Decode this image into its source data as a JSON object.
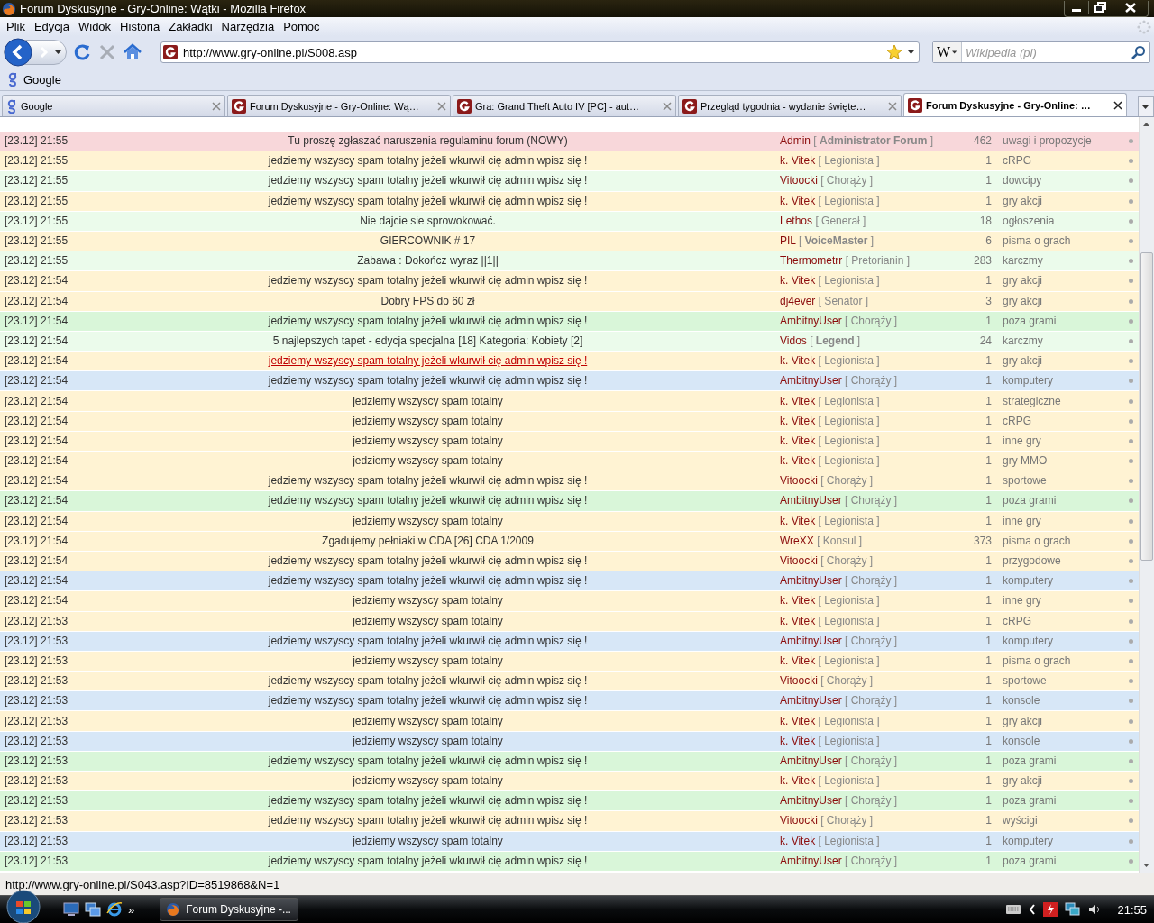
{
  "window": {
    "title": "Forum Dyskusyjne - Gry-Online: Wątki - Mozilla Firefox"
  },
  "menu": [
    "Plik",
    "Edycja",
    "Widok",
    "Historia",
    "Zakładki",
    "Narzędzia",
    "Pomoc"
  ],
  "navigation": {
    "url": "http://www.gry-online.pl/S008.asp",
    "search_engine": "W",
    "search_placeholder": "Wikipedia (pl)",
    "stop_disabled": true
  },
  "bookmarks": [
    "Google"
  ],
  "tabs": [
    {
      "title": "Google",
      "kind": "google",
      "selected": false
    },
    {
      "title": "Forum Dyskusyjne - Gry-Online: Wą…",
      "kind": "site",
      "selected": false
    },
    {
      "title": "Gra: Grand Theft Auto IV [PC] - aut…",
      "kind": "site",
      "selected": false
    },
    {
      "title": "Przegląd tygodnia - wydanie święte…",
      "kind": "site",
      "selected": false
    },
    {
      "title": "Forum Dyskusyjne - Gry-Online: …",
      "kind": "site",
      "selected": true
    }
  ],
  "threads": [
    {
      "time": "[23.12] 21:55",
      "title": "Tu proszę zgłaszać naruszenia regulaminu forum (NOWY)",
      "author": "Admin",
      "rank": "[ **Administrator Forum** ]",
      "count": "462",
      "category": "uwagi i propozycje",
      "color": "#f8d7da",
      "hovered": false
    },
    {
      "time": "[23.12] 21:55",
      "title": "jedziemy wszyscy spam totalny jeżeli wkurwił cię admin wpisz się !",
      "author": "k. Vitek",
      "rank": "[ Legionista ]",
      "count": "1",
      "category": "cRPG",
      "color": "#fff3d3",
      "hovered": false
    },
    {
      "time": "[23.12] 21:55",
      "title": "jedziemy wszyscy spam totalny jeżeli wkurwił cię admin wpisz się !",
      "author": "Vitoocki",
      "rank": "[ Chorąży ]",
      "count": "1",
      "category": "dowcipy",
      "color": "#ebfbeb",
      "hovered": false
    },
    {
      "time": "[23.12] 21:55",
      "title": "jedziemy wszyscy spam totalny jeżeli wkurwił cię admin wpisz się !",
      "author": "k. Vitek",
      "rank": "[ Legionista ]",
      "count": "1",
      "category": "gry akcji",
      "color": "#fff3d3",
      "hovered": false
    },
    {
      "time": "[23.12] 21:55",
      "title": "Nie dajcie sie sprowokować.",
      "author": "Lethos",
      "rank": "[ Generał ]",
      "count": "18",
      "category": "ogłoszenia",
      "color": "#ebfbeb",
      "hovered": false
    },
    {
      "time": "[23.12] 21:55",
      "title": "GIERCOWNIK # 17",
      "author": "PIL",
      "rank": "[ **VoiceMaster** ]",
      "count": "6",
      "category": "pisma o grach",
      "color": "#fff3d3",
      "hovered": false
    },
    {
      "time": "[23.12] 21:55",
      "title": "Zabawa : Dokończ wyraz ||1||",
      "author": "Thermometrr",
      "rank": "[ Pretorianin ]",
      "count": "283",
      "category": "karczmy",
      "color": "#ebfbeb",
      "hovered": false
    },
    {
      "time": "[23.12] 21:54",
      "title": "jedziemy wszyscy spam totalny jeżeli wkurwił cię admin wpisz się !",
      "author": "k. Vitek",
      "rank": "[ Legionista ]",
      "count": "1",
      "category": "gry akcji",
      "color": "#fff3d3",
      "hovered": false
    },
    {
      "time": "[23.12] 21:54",
      "title": "Dobry FPS do 60 zł",
      "author": "dj4ever",
      "rank": "[ Senator ]",
      "count": "3",
      "category": "gry akcji",
      "color": "#fff3d3",
      "hovered": false
    },
    {
      "time": "[23.12] 21:54",
      "title": "jedziemy wszyscy spam totalny jeżeli wkurwił cię admin wpisz się !",
      "author": "AmbitnyUser",
      "rank": "[ Chorąży ]",
      "count": "1",
      "category": "poza grami",
      "color": "#d9f6d9",
      "hovered": false
    },
    {
      "time": "[23.12] 21:54",
      "title": "5 najlepszych tapet - edycja specjalna [18] Kategoria: Kobiety [2]",
      "author": "Vidos",
      "rank": "[ **Legend** ]",
      "count": "24",
      "category": "karczmy",
      "color": "#ebfbeb",
      "hovered": false
    },
    {
      "time": "[23.12] 21:54",
      "title": "jedziemy wszyscy spam totalny jeżeli wkurwił cię admin wpisz się !",
      "author": "k. Vitek",
      "rank": "[ Legionista ]",
      "count": "1",
      "category": "gry akcji",
      "color": "#fff3d3",
      "hovered": true
    },
    {
      "time": "[23.12] 21:54",
      "title": "jedziemy wszyscy spam totalny jeżeli wkurwił cię admin wpisz się !",
      "author": "AmbitnyUser",
      "rank": "[ Chorąży ]",
      "count": "1",
      "category": "komputery",
      "color": "#d7e7f7",
      "hovered": false
    },
    {
      "time": "[23.12] 21:54",
      "title": "jedziemy wszyscy spam totalny",
      "author": "k. Vitek",
      "rank": "[ Legionista ]",
      "count": "1",
      "category": "strategiczne",
      "color": "#fff3d3",
      "hovered": false
    },
    {
      "time": "[23.12] 21:54",
      "title": "jedziemy wszyscy spam totalny",
      "author": "k. Vitek",
      "rank": "[ Legionista ]",
      "count": "1",
      "category": "cRPG",
      "color": "#fff3d3",
      "hovered": false
    },
    {
      "time": "[23.12] 21:54",
      "title": "jedziemy wszyscy spam totalny",
      "author": "k. Vitek",
      "rank": "[ Legionista ]",
      "count": "1",
      "category": "inne gry",
      "color": "#fff3d3",
      "hovered": false
    },
    {
      "time": "[23.12] 21:54",
      "title": "jedziemy wszyscy spam totalny",
      "author": "k. Vitek",
      "rank": "[ Legionista ]",
      "count": "1",
      "category": "gry MMO",
      "color": "#fff3d3",
      "hovered": false
    },
    {
      "time": "[23.12] 21:54",
      "title": "jedziemy wszyscy spam totalny jeżeli wkurwił cię admin wpisz się !",
      "author": "Vitoocki",
      "rank": "[ Chorąży ]",
      "count": "1",
      "category": "sportowe",
      "color": "#fff3d3",
      "hovered": false
    },
    {
      "time": "[23.12] 21:54",
      "title": "jedziemy wszyscy spam totalny jeżeli wkurwił cię admin wpisz się !",
      "author": "AmbitnyUser",
      "rank": "[ Chorąży ]",
      "count": "1",
      "category": "poza grami",
      "color": "#d9f6d9",
      "hovered": false
    },
    {
      "time": "[23.12] 21:54",
      "title": "jedziemy wszyscy spam totalny",
      "author": "k. Vitek",
      "rank": "[ Legionista ]",
      "count": "1",
      "category": "inne gry",
      "color": "#fff3d3",
      "hovered": false
    },
    {
      "time": "[23.12] 21:54",
      "title": "Zgadujemy pełniaki w CDA [26] CDA 1/2009",
      "author": "WreXX",
      "rank": "[ Konsul ]",
      "count": "373",
      "category": "pisma o grach",
      "color": "#fff3d3",
      "hovered": false
    },
    {
      "time": "[23.12] 21:54",
      "title": "jedziemy wszyscy spam totalny jeżeli wkurwił cię admin wpisz się !",
      "author": "Vitoocki",
      "rank": "[ Chorąży ]",
      "count": "1",
      "category": "przygodowe",
      "color": "#fff3d3",
      "hovered": false
    },
    {
      "time": "[23.12] 21:54",
      "title": "jedziemy wszyscy spam totalny jeżeli wkurwił cię admin wpisz się !",
      "author": "AmbitnyUser",
      "rank": "[ Chorąży ]",
      "count": "1",
      "category": "komputery",
      "color": "#d7e7f7",
      "hovered": false
    },
    {
      "time": "[23.12] 21:54",
      "title": "jedziemy wszyscy spam totalny",
      "author": "k. Vitek",
      "rank": "[ Legionista ]",
      "count": "1",
      "category": "inne gry",
      "color": "#fff3d3",
      "hovered": false
    },
    {
      "time": "[23.12] 21:53",
      "title": "jedziemy wszyscy spam totalny",
      "author": "k. Vitek",
      "rank": "[ Legionista ]",
      "count": "1",
      "category": "cRPG",
      "color": "#fff3d3",
      "hovered": false
    },
    {
      "time": "[23.12] 21:53",
      "title": "jedziemy wszyscy spam totalny jeżeli wkurwił cię admin wpisz się !",
      "author": "AmbitnyUser",
      "rank": "[ Chorąży ]",
      "count": "1",
      "category": "komputery",
      "color": "#d7e7f7",
      "hovered": false
    },
    {
      "time": "[23.12] 21:53",
      "title": "jedziemy wszyscy spam totalny",
      "author": "k. Vitek",
      "rank": "[ Legionista ]",
      "count": "1",
      "category": "pisma o grach",
      "color": "#fff3d3",
      "hovered": false
    },
    {
      "time": "[23.12] 21:53",
      "title": "jedziemy wszyscy spam totalny jeżeli wkurwił cię admin wpisz się !",
      "author": "Vitoocki",
      "rank": "[ Chorąży ]",
      "count": "1",
      "category": "sportowe",
      "color": "#fff3d3",
      "hovered": false
    },
    {
      "time": "[23.12] 21:53",
      "title": "jedziemy wszyscy spam totalny jeżeli wkurwił cię admin wpisz się !",
      "author": "AmbitnyUser",
      "rank": "[ Chorąży ]",
      "count": "1",
      "category": "konsole",
      "color": "#d7e7f7",
      "hovered": false
    },
    {
      "time": "[23.12] 21:53",
      "title": "jedziemy wszyscy spam totalny",
      "author": "k. Vitek",
      "rank": "[ Legionista ]",
      "count": "1",
      "category": "gry akcji",
      "color": "#fff3d3",
      "hovered": false
    },
    {
      "time": "[23.12] 21:53",
      "title": "jedziemy wszyscy spam totalny",
      "author": "k. Vitek",
      "rank": "[ Legionista ]",
      "count": "1",
      "category": "konsole",
      "color": "#d7e7f7",
      "hovered": false
    },
    {
      "time": "[23.12] 21:53",
      "title": "jedziemy wszyscy spam totalny jeżeli wkurwił cię admin wpisz się !",
      "author": "AmbitnyUser",
      "rank": "[ Chorąży ]",
      "count": "1",
      "category": "poza grami",
      "color": "#d9f6d9",
      "hovered": false
    },
    {
      "time": "[23.12] 21:53",
      "title": "jedziemy wszyscy spam totalny",
      "author": "k. Vitek",
      "rank": "[ Legionista ]",
      "count": "1",
      "category": "gry akcji",
      "color": "#fff3d3",
      "hovered": false
    },
    {
      "time": "[23.12] 21:53",
      "title": "jedziemy wszyscy spam totalny jeżeli wkurwił cię admin wpisz się !",
      "author": "AmbitnyUser",
      "rank": "[ Chorąży ]",
      "count": "1",
      "category": "poza grami",
      "color": "#d9f6d9",
      "hovered": false
    },
    {
      "time": "[23.12] 21:53",
      "title": "jedziemy wszyscy spam totalny jeżeli wkurwił cię admin wpisz się !",
      "author": "Vitoocki",
      "rank": "[ Chorąży ]",
      "count": "1",
      "category": "wyścigi",
      "color": "#fff3d3",
      "hovered": false
    },
    {
      "time": "[23.12] 21:53",
      "title": "jedziemy wszyscy spam totalny",
      "author": "k. Vitek",
      "rank": "[ Legionista ]",
      "count": "1",
      "category": "komputery",
      "color": "#d7e7f7",
      "hovered": false
    },
    {
      "time": "[23.12] 21:53",
      "title": "jedziemy wszyscy spam totalny jeżeli wkurwił cię admin wpisz się !",
      "author": "AmbitnyUser",
      "rank": "[ Chorąży ]",
      "count": "1",
      "category": "poza grami",
      "color": "#d9f6d9",
      "hovered": false
    }
  ],
  "status_bar": {
    "text": "http://www.gry-online.pl/S043.asp?ID=8519868&N=1"
  },
  "taskbar": {
    "quick_launch_more": "»",
    "window_button": "Forum Dyskusyjne -...",
    "clock": "21:55"
  }
}
